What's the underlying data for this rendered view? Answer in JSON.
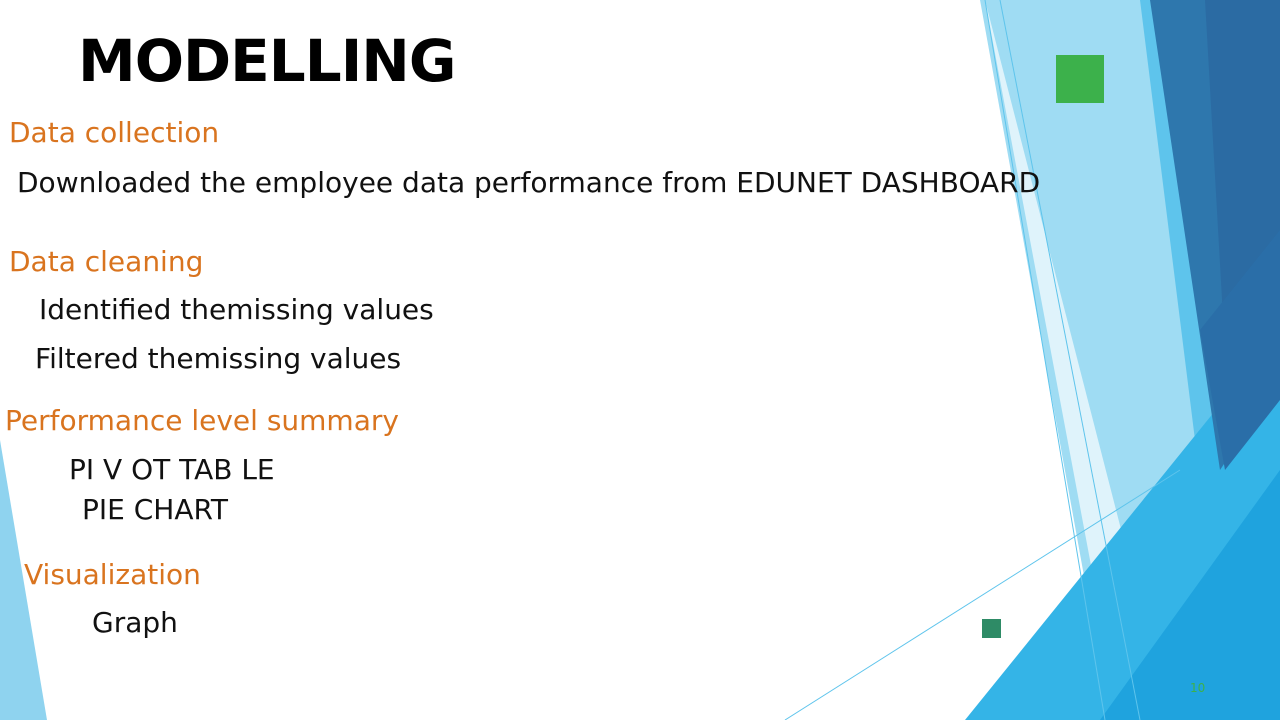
{
  "slide": {
    "title": "MODELLING",
    "slide_number": "10"
  },
  "sections": {
    "data_collection": {
      "heading": "Data collection",
      "items": [
        "Downloaded the employee data performance from EDUNET DASHBOARD"
      ]
    },
    "data_cleaning": {
      "heading": "Data cleaning",
      "items": [
        "Identified themissing values",
        "Filtered themissing values"
      ]
    },
    "performance_summary": {
      "heading": "Performance level summary",
      "items": [
        "PI V OT TAB LE",
        "PIE CHART"
      ]
    },
    "visualization": {
      "heading": "Visualization",
      "items": [
        "Graph"
      ]
    }
  },
  "colors": {
    "heading": "#d9741f",
    "body_text": "#111111",
    "title": "#000000",
    "accent_green": "#3cb14b",
    "accent_teal": "#2e8b66",
    "slide_number": "#3cb14b"
  }
}
